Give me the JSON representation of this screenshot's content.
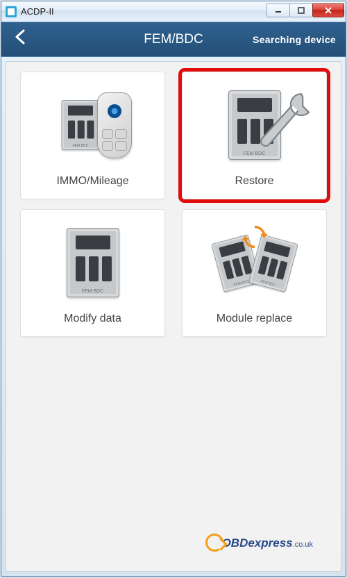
{
  "window": {
    "title": "ACDP-II"
  },
  "appbar": {
    "heading": "FEM/BDC",
    "status": "Searching device"
  },
  "tiles": [
    {
      "label": "IMMO/Mileage"
    },
    {
      "label": "Restore"
    },
    {
      "label": "Modify data"
    },
    {
      "label": "Module replace"
    }
  ],
  "highlighted_tile_index": 1,
  "watermark": {
    "brand": "OBDexpress",
    "suffix": ".co.uk"
  },
  "ecu_chip_label": "FEM BDC"
}
